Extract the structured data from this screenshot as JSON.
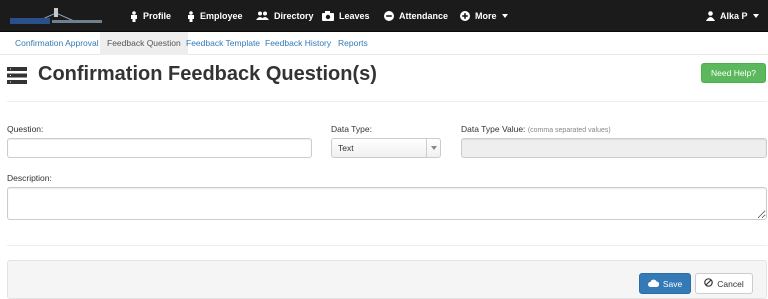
{
  "nav": {
    "items": [
      {
        "label": "Profile",
        "icon": "person-icon"
      },
      {
        "label": "Employee",
        "icon": "person-icon"
      },
      {
        "label": "Directory",
        "icon": "users-icon"
      },
      {
        "label": "Leaves",
        "icon": "camera-icon"
      },
      {
        "label": "Attendance",
        "icon": "minus-circle-icon"
      },
      {
        "label": "More",
        "icon": "plus-circle-icon"
      }
    ],
    "user": "Alka P"
  },
  "subnav": {
    "items": [
      {
        "label": "Confirmation Approval"
      },
      {
        "label": "Feedback Question"
      },
      {
        "label": "Feedback Template"
      },
      {
        "label": "Feedback History"
      },
      {
        "label": "Reports"
      }
    ],
    "active": "Feedback Question"
  },
  "page": {
    "title": "Confirmation Feedback Question(s)",
    "help_label": "Need Help?"
  },
  "form": {
    "question_label": "Question:",
    "question_value": "",
    "data_type_label": "Data Type:",
    "data_type_value": "Text",
    "data_type_value_label": "Data Type Value:",
    "data_type_value_hint": "(comma separated values)",
    "data_type_value_value": "",
    "description_label": "Description:",
    "description_value": ""
  },
  "actions": {
    "save_label": "Save",
    "cancel_label": "Cancel"
  },
  "colors": {
    "navbar": "#1b1b1b",
    "link": "#337ab7",
    "help": "#5cb85c",
    "primary": "#337ab7"
  }
}
